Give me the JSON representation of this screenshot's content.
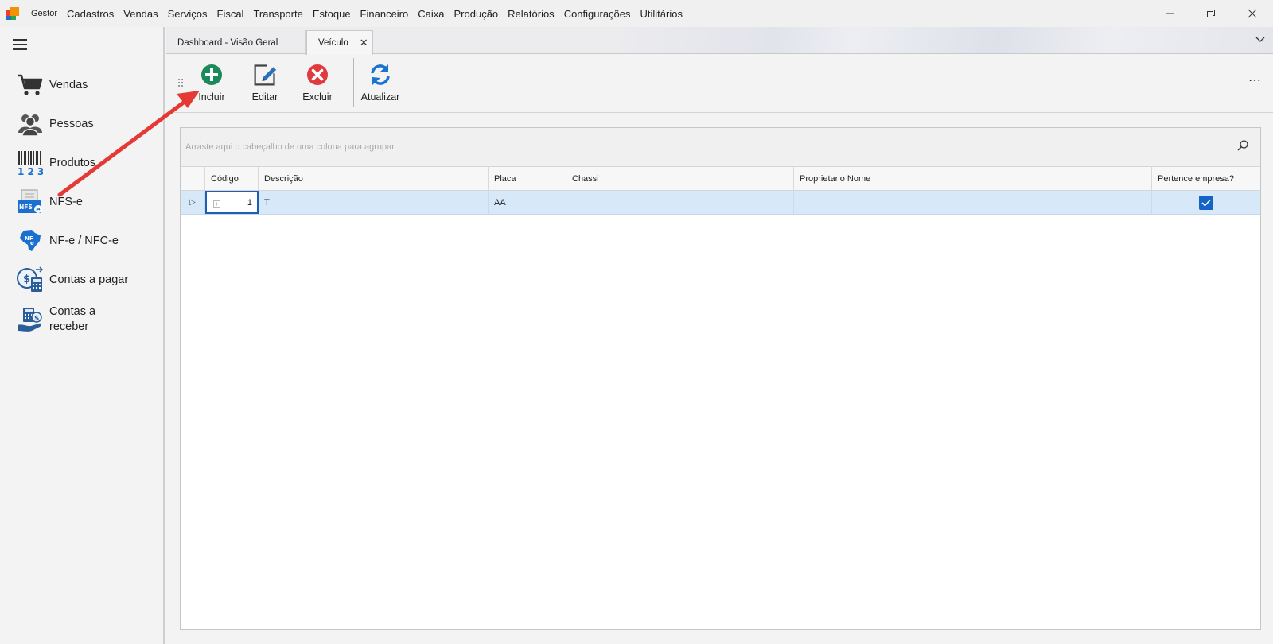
{
  "menu": {
    "items": [
      "Gestor",
      "Cadastros",
      "Vendas",
      "Serviços",
      "Fiscal",
      "Transporte",
      "Estoque",
      "Financeiro",
      "Caixa",
      "Produção",
      "Relatórios",
      "Configurações",
      "Utilitários"
    ]
  },
  "window": {
    "minimize": "—",
    "restore": "❐",
    "close": "✕"
  },
  "sidebar": {
    "items": [
      {
        "label": "Vendas",
        "icon": "shopping-cart-icon"
      },
      {
        "label": "Pessoas",
        "icon": "people-icon"
      },
      {
        "label": "Produtos",
        "icon": "barcode-icon"
      },
      {
        "label": "NFS-e",
        "icon": "nfse-icon"
      },
      {
        "label": "NF-e / NFC-e",
        "icon": "nfe-map-icon"
      },
      {
        "label": "Contas a pagar",
        "icon": "accounts-payable-icon"
      },
      {
        "label": "Contas a receber",
        "icon": "accounts-receivable-icon"
      }
    ]
  },
  "tabs": [
    {
      "label": "Dashboard - Visão Geral",
      "active": false
    },
    {
      "label": "Veículo",
      "active": true
    }
  ],
  "toolbar": {
    "buttons": [
      {
        "label": "Incluir",
        "icon": "add-icon",
        "color": "#1b8a5a"
      },
      {
        "label": "Editar",
        "icon": "edit-icon",
        "color": "#2f6fb8"
      },
      {
        "label": "Excluir",
        "icon": "delete-icon",
        "color": "#e0393e"
      },
      {
        "label": "Atualizar",
        "icon": "refresh-icon",
        "color": "#1a73d1"
      }
    ],
    "more": "⋯"
  },
  "grid": {
    "group_hint": "Arraste aqui o cabeçalho de uma coluna para agrupar",
    "columns": [
      "Código",
      "Descrição",
      "Placa",
      "Chassi",
      "Proprietario Nome",
      "Pertence empresa?"
    ],
    "rows": [
      {
        "codigo": "1",
        "descricao": "T",
        "placa": "AA",
        "chassi": "",
        "proprietario": "",
        "pertence_empresa": true
      }
    ],
    "expand_symbol": "+",
    "row_indicator": "▷"
  },
  "colors": {
    "selected_row": "#d7e8f8",
    "checkbox": "#1463c7",
    "annotation_arrow": "#e53935"
  }
}
